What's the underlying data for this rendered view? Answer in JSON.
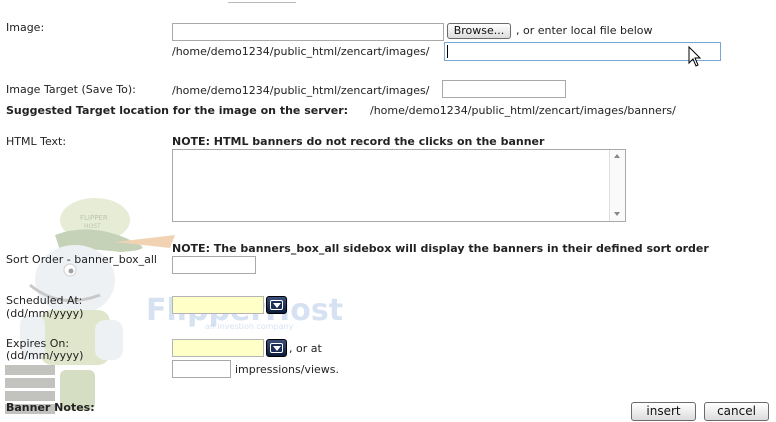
{
  "labels": {
    "image": "Image:",
    "image_target": "Image Target (Save To):",
    "suggested_prefix": "Suggested Target location for the image on the server:",
    "suggested_path": "/home/demo1234/public_html/zencart/images/banners/",
    "html_text": "HTML Text:",
    "html_note": "NOTE: HTML banners do not record the clicks on the banner",
    "sort_order": "Sort Order - banner_box_all",
    "sort_note": "NOTE: The banners_box_all sidebox will display the banners in their defined sort order",
    "scheduled_at": "Scheduled At:",
    "scheduled_fmt": "(dd/mm/yyyy)",
    "expires_on": "Expires On:",
    "expires_fmt": "(dd/mm/yyyy)",
    "or_at": ", or at",
    "impressions": "impressions/views.",
    "banner_notes": "Banner Notes:",
    "or_local": ", or enter local file below",
    "local_prefix": "/home/demo1234/public_html/zencart/images/",
    "target_prefix": "/home/demo1234/public_html/zencart/images/"
  },
  "buttons": {
    "browse": "Browse...",
    "insert": "insert",
    "cancel": "cancel"
  },
  "fields": {
    "image_file": "",
    "local_file": "",
    "image_target": "",
    "html_text": "",
    "sort_order": "",
    "scheduled_at": "",
    "expires_on": "",
    "impressions": ""
  },
  "watermark": {
    "brand": "FlipperHost",
    "tagline": "an investion company",
    "cap_text": "FLIPPER HOST"
  },
  "colors": {
    "date_field": "#ffffc8",
    "calendar_button": "#1d2f57"
  }
}
